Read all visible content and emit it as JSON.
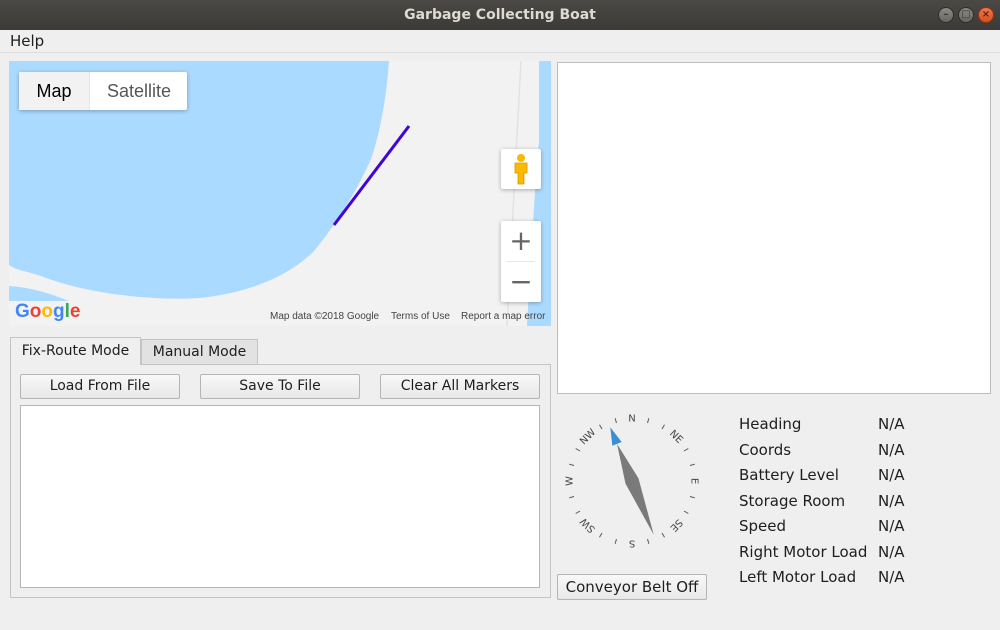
{
  "window": {
    "title": "Garbage Collecting Boat"
  },
  "menu": {
    "help": "Help"
  },
  "map": {
    "type_map": "Map",
    "type_satellite": "Satellite",
    "logo_letters": [
      "G",
      "o",
      "o",
      "g",
      "l",
      "e"
    ],
    "logo_colors": [
      "#4285F4",
      "#EA4335",
      "#FBBC05",
      "#4285F4",
      "#34A853",
      "#EA4335"
    ],
    "attribution": "Map data ©2018 Google",
    "terms": "Terms of Use",
    "report": "Report a map error",
    "zoom_in": "+",
    "zoom_out": "−",
    "water_color": "#aadaff",
    "land_color": "#f2f2f2",
    "route_color": "#3f06d6"
  },
  "tabs": {
    "fix_route": "Fix-Route Mode",
    "manual": "Manual Mode"
  },
  "buttons": {
    "load": "Load From File",
    "save": "Save To File",
    "clear": "Clear All Markers",
    "conveyor": "Conveyor Belt Off"
  },
  "compass": {
    "directions": [
      "N",
      "NE",
      "E",
      "SE",
      "S",
      "SW",
      "W",
      "NW"
    ],
    "needle_north_color": "#3a8fd0",
    "needle_color": "#7a7a7a"
  },
  "telemetry": [
    {
      "label": "Heading",
      "value": "N/A"
    },
    {
      "label": "Coords",
      "value": "N/A"
    },
    {
      "label": "Battery Level",
      "value": "N/A"
    },
    {
      "label": "Storage Room",
      "value": "N/A"
    },
    {
      "label": "Speed",
      "value": "N/A"
    },
    {
      "label": "Right Motor Load",
      "value": "N/A"
    },
    {
      "label": "Left Motor Load",
      "value": "N/A"
    }
  ]
}
